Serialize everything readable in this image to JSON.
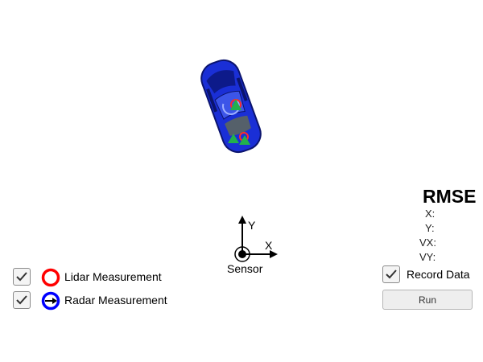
{
  "scene": {
    "sensor_label": "Sensor",
    "axis_x_label": "X",
    "axis_y_label": "Y"
  },
  "rmse": {
    "title": "RMSE",
    "rows": [
      {
        "label": "X:",
        "value": ""
      },
      {
        "label": "Y:",
        "value": ""
      },
      {
        "label": "VX:",
        "value": ""
      },
      {
        "label": "VY:",
        "value": ""
      }
    ]
  },
  "legend": {
    "lidar": {
      "label": "Lidar Measurement",
      "checked": true,
      "icon": "red-circle-icon",
      "color": "#ff0000"
    },
    "radar": {
      "label": "Radar Measurement",
      "checked": true,
      "icon": "blue-circle-arrow-icon",
      "color": "#0000ff"
    }
  },
  "controls": {
    "record_label": "Record Data",
    "record_checked": true,
    "run_label": "Run"
  },
  "colors": {
    "car_body": "#1a2fd6",
    "marker_green": "#22b14c",
    "marker_red": "#ff2a2a"
  }
}
